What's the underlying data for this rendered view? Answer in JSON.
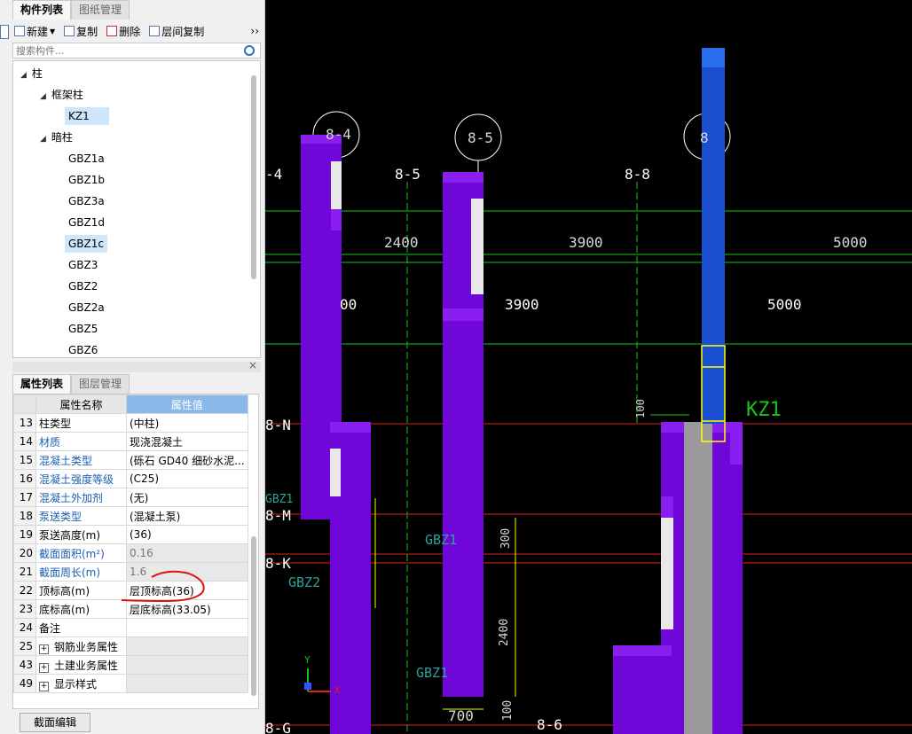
{
  "top_panel": {
    "tabs": [
      "构件列表",
      "图纸管理"
    ],
    "toolbar": {
      "new": "新建",
      "copy": "复制",
      "delete": "删除",
      "floor_copy": "层间复制",
      "more": "››"
    },
    "search_placeholder": "搜索构件...",
    "tree": {
      "root": "柱",
      "group1": "框架柱",
      "group1_items": [
        "KZ1"
      ],
      "group2": "暗柱",
      "group2_items": [
        "GBZ1a",
        "GBZ1b",
        "GBZ3a",
        "GBZ1d",
        "GBZ1c",
        "GBZ3",
        "GBZ2",
        "GBZ2a",
        "GBZ5",
        "GBZ6"
      ]
    }
  },
  "attr_panel": {
    "tabs": [
      "属性列表",
      "图层管理"
    ],
    "close": "×",
    "headers": {
      "name": "属性名称",
      "value": "属性值"
    },
    "rows": [
      {
        "n": "13",
        "name": "柱类型",
        "value": "(中柱)"
      },
      {
        "n": "14",
        "name": "材质",
        "value": "现浇混凝土"
      },
      {
        "n": "15",
        "name": "混凝土类型",
        "value": "(砾石 GD40 细砂水泥..."
      },
      {
        "n": "16",
        "name": "混凝土强度等级",
        "value": "(C25)"
      },
      {
        "n": "17",
        "name": "混凝土外加剂",
        "value": "(无)"
      },
      {
        "n": "18",
        "name": "泵送类型",
        "value": "(混凝土泵)"
      },
      {
        "n": "19",
        "name": "泵送高度(m)",
        "value": "(36)"
      },
      {
        "n": "20",
        "name": "截面面积(m²)",
        "value": "0.16"
      },
      {
        "n": "21",
        "name": "截面周长(m)",
        "value": "1.6"
      },
      {
        "n": "22",
        "name": "顶标高(m)",
        "value": "层顶标高(36)"
      },
      {
        "n": "23",
        "name": "底标高(m)",
        "value": "层底标高(33.05)"
      },
      {
        "n": "24",
        "name": "备注",
        "value": ""
      },
      {
        "n": "25",
        "name": "钢筋业务属性",
        "value": ""
      },
      {
        "n": "43",
        "name": "土建业务属性",
        "value": ""
      },
      {
        "n": "49",
        "name": "显示样式",
        "value": ""
      }
    ],
    "edit_button": "截面编辑"
  },
  "cad": {
    "axis_labels": [
      "8-4",
      "8-5",
      "8",
      "-4",
      "8-5",
      "8-8",
      "8-N",
      "8-M",
      "8-K",
      "8-G",
      "8-6"
    ],
    "dims": [
      "2400",
      "3900",
      "5000",
      "00",
      "3900",
      "5000",
      "100",
      "300",
      "2400",
      "100",
      "700"
    ],
    "tags": [
      "KZ1",
      "GBZ1",
      "GBZ2",
      "GBZ1",
      "GBZ1"
    ],
    "ucs": {
      "y": "Y",
      "x": "X"
    },
    "colors": {
      "column": "#6f07d8",
      "column_light": "#8a1ef0",
      "kz1": "#1a4fd0",
      "grid": "#19c419",
      "axis_red": "#e0201b",
      "gray": "#9a9a9a"
    }
  }
}
